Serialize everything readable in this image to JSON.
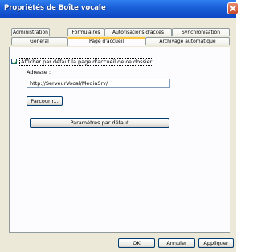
{
  "window": {
    "title": "Propriétés de Boîte vocale"
  },
  "tabs_back": [
    {
      "label": "Administration"
    },
    {
      "label": "Formulaires"
    },
    {
      "label": "Autorisations d'accès"
    },
    {
      "label": "Synchronisation"
    }
  ],
  "tabs_front": [
    {
      "label": "Général"
    },
    {
      "label": "Page d'accueil",
      "active": true
    },
    {
      "label": "Archivage automatique"
    }
  ],
  "homepage": {
    "checkbox_label": "Afficher par défaut la page d'accueil de ce dossier",
    "checkbox_checked": true,
    "address_label": "Adresse :",
    "address_value": "http://ServeurVocal/MediaSrv/",
    "browse_label": "Parcourir...",
    "defaults_label": "Paramètres par défaut"
  },
  "footer": {
    "ok_label": "OK",
    "cancel_label": "Annuler",
    "apply_label": "Appliquer"
  },
  "colors": {
    "titlebar": "#0c46c4",
    "dialog_bg": "#ece9d8",
    "active_tab_accent": "#ffc73c"
  }
}
